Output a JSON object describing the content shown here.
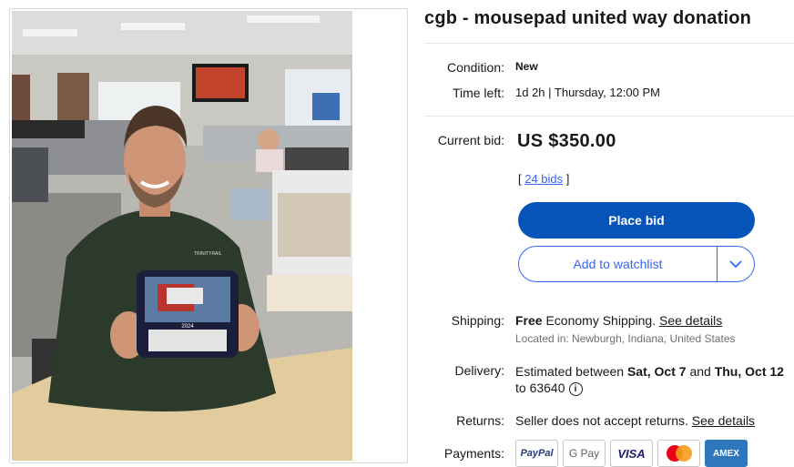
{
  "listing": {
    "title": "cgb - mousepad united way donation"
  },
  "condition": {
    "label": "Condition:",
    "value": "New"
  },
  "time_left": {
    "label": "Time left:",
    "value": "1d 2h | Thursday, 12:00 PM"
  },
  "bid": {
    "label": "Current bid:",
    "price": "US $350.00",
    "bids_open": "[ ",
    "bids_link": "24 bids",
    "bids_close": " ]"
  },
  "buttons": {
    "place_bid": "Place bid",
    "watchlist": "Add to watchlist"
  },
  "shipping": {
    "label": "Shipping:",
    "free": "Free",
    "method": " Economy Shipping. ",
    "details_link": "See details",
    "location": "Located in: Newburgh, Indiana, United States"
  },
  "delivery": {
    "label": "Delivery:",
    "prefix": "Estimated between ",
    "date1": "Sat, Oct 7",
    "and": " and ",
    "date2": "Thu, Oct 12",
    "to": " to 63640"
  },
  "returns": {
    "label": "Returns:",
    "text": "Seller does not accept returns. ",
    "details_link": "See details"
  },
  "payments": {
    "label": "Payments:",
    "methods": [
      "PayPal",
      "G Pay",
      "VISA",
      "Mastercard",
      "AMEX"
    ]
  },
  "photo": {
    "shirt_text": "TRINITYRAIL",
    "mousepad_year": "2024"
  },
  "colors": {
    "primary": "#0654ba",
    "link": "#3665f3",
    "text": "#191919"
  }
}
